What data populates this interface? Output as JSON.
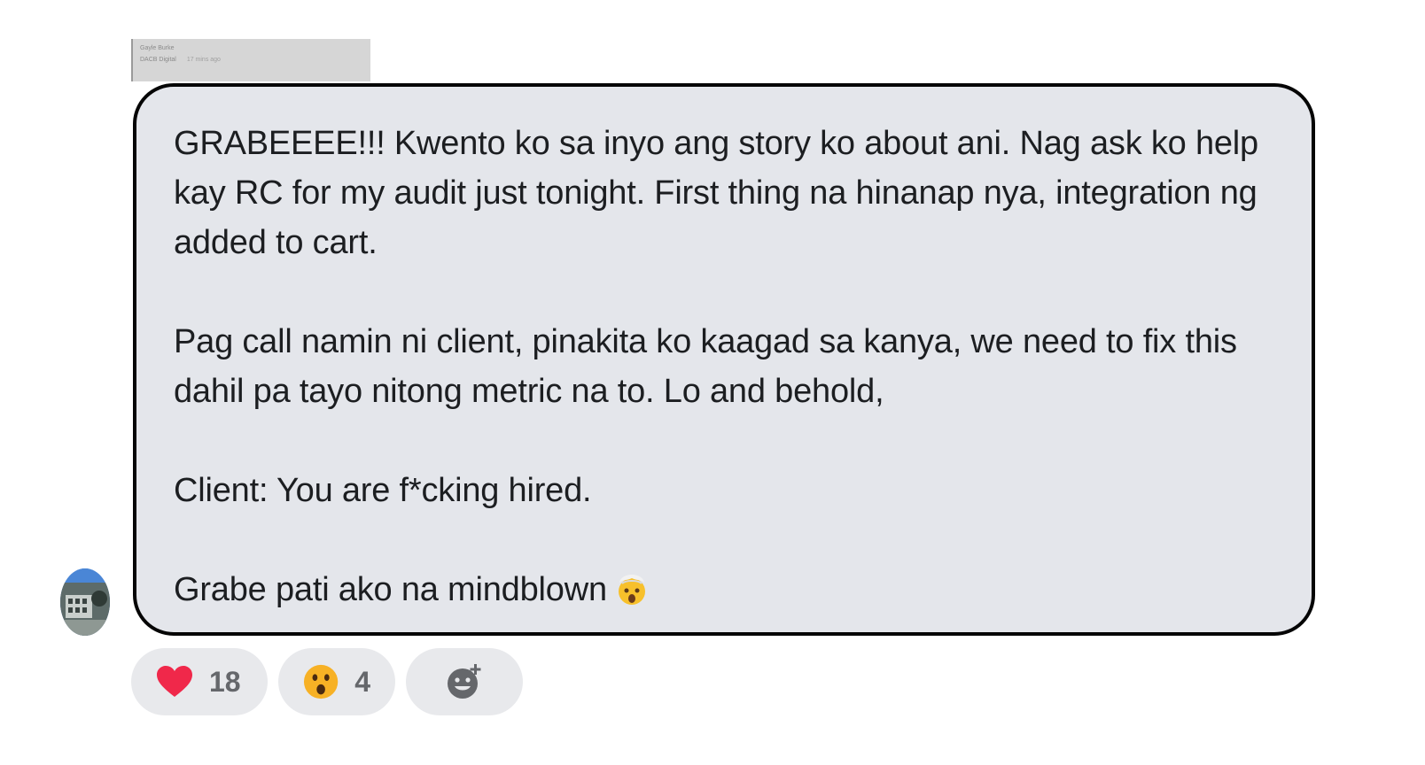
{
  "reply_preview": {
    "line1": "Gayle Burke",
    "line2_name": "DACB Digital",
    "line2_time": "17 mins ago"
  },
  "message": {
    "paragraphs": [
      "GRABEEEE!!! Kwento ko sa inyo ang story ko about ani. Nag ask ko help kay RC for my audit just tonight. First thing na hinanap nya, integration ng added to cart.",
      "Pag call namin ni client, pinakita ko kaagad sa kanya, we need to fix this dahil pa tayo nitong metric na to. Lo and behold,",
      "Client: You are f*cking hired.",
      "Grabe pati ako na mindblown"
    ],
    "trailing_emoji": "exploding-head-icon"
  },
  "reactions": [
    {
      "icon": "heart-icon",
      "count": "18"
    },
    {
      "icon": "wow-face-icon",
      "count": "4"
    },
    {
      "icon": "add-reaction-icon",
      "count": ""
    }
  ],
  "colors": {
    "bubble_background": "#e4e6eb",
    "bubble_border": "#050505",
    "text": "#1c1e21",
    "reaction_background": "#e8e9ec",
    "reaction_count": "#65676b",
    "heart": "#f0284a",
    "wow": "#f7b125"
  }
}
